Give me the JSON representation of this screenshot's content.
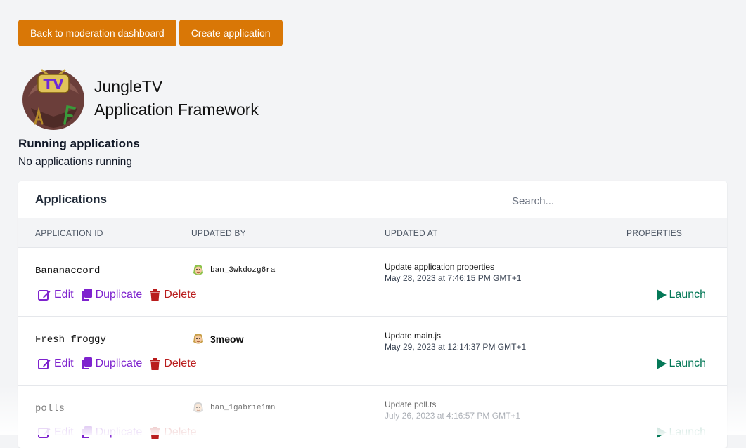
{
  "topbar": {
    "back_label": "Back to moderation dashboard",
    "create_label": "Create application"
  },
  "brand": {
    "logo_text": "TV",
    "line1": "JungleTV",
    "line2": "Application Framework"
  },
  "running": {
    "title": "Running applications",
    "empty_text": "No applications running"
  },
  "table": {
    "title": "Applications",
    "search_placeholder": "Search...",
    "columns": [
      "APPLICATION ID",
      "UPDATED BY",
      "UPDATED AT",
      "PROPERTIES"
    ],
    "action_labels": {
      "edit": "Edit",
      "duplicate": "Duplicate",
      "delete": "Delete",
      "launch": "Launch"
    },
    "rows": [
      {
        "id": "Bananaccord",
        "updated_by": "ban_3wkdozg6ra",
        "commit": "Update application properties",
        "date": "May 28, 2023 at 7:46:15 PM GMT+1"
      },
      {
        "id": "Fresh froggy",
        "updated_by": "3meow",
        "commit": "Update main.js",
        "date": "May 29, 2023 at 12:14:37 PM GMT+1"
      },
      {
        "id": "polls",
        "updated_by": "ban_1gabrie1mn",
        "commit": "Update poll.ts",
        "date": "July 26, 2023 at 4:16:57 PM GMT+1"
      }
    ]
  },
  "colors": {
    "accent_orange": "#d97706",
    "action_purple": "#7e22ce",
    "delete_red": "#b91c1c",
    "launch_green": "#047857"
  },
  "icons": [
    "edit-icon",
    "duplicate-icon",
    "delete-icon",
    "play-icon",
    "avatar-icon"
  ]
}
